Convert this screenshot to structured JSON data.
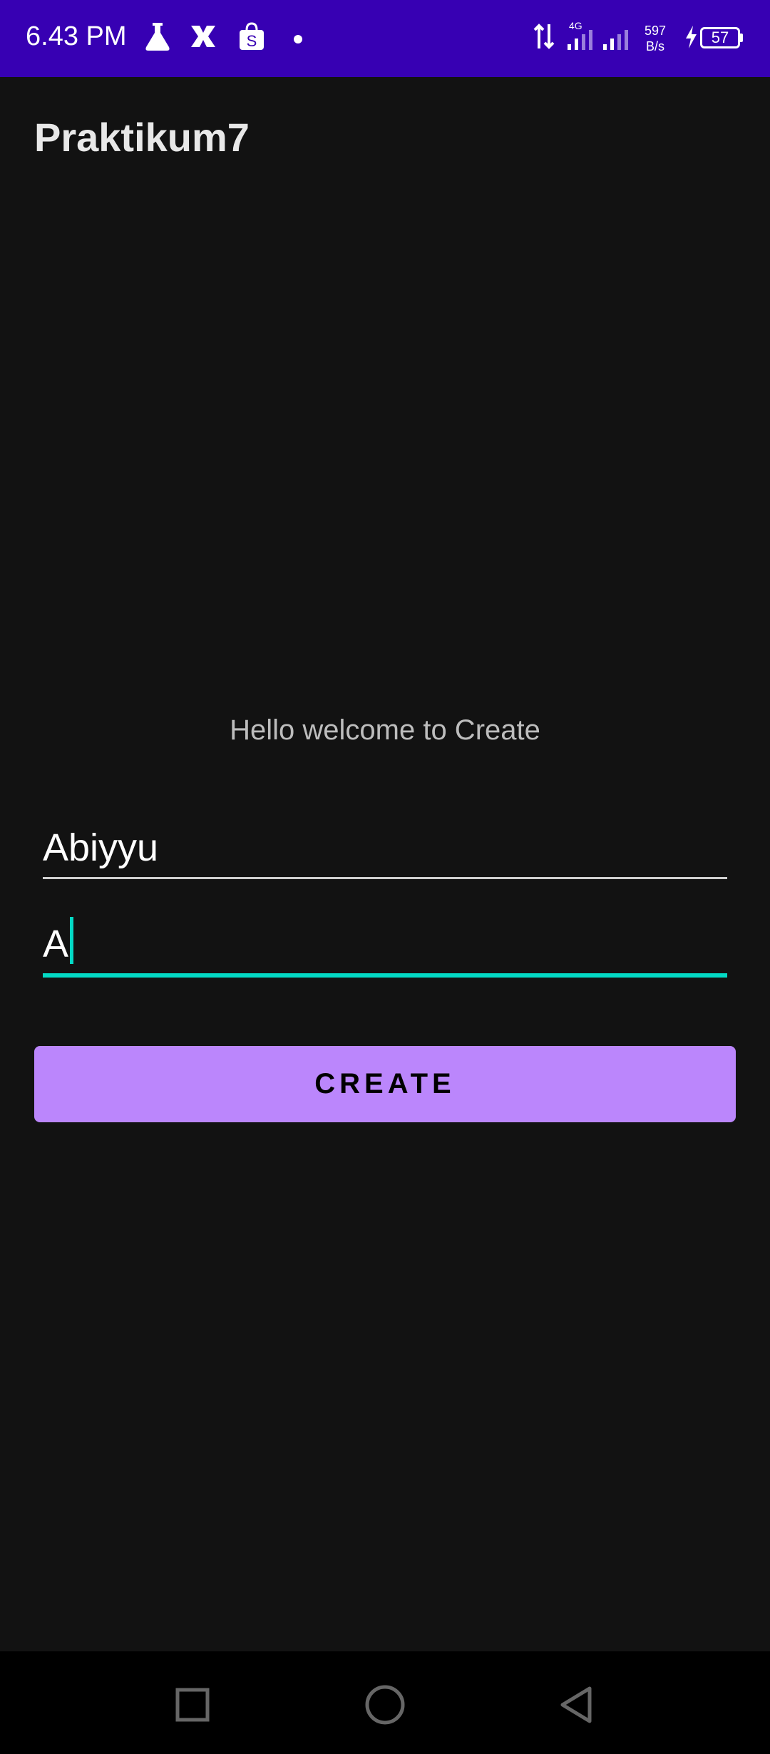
{
  "status_bar": {
    "time": "6.43 PM",
    "network_type": "4G",
    "net_speed_value": "597",
    "net_speed_unit": "B/s",
    "battery_level": "57",
    "background_color": "#3700b3"
  },
  "app": {
    "title": "Praktikum7"
  },
  "main": {
    "welcome_text": "Hello welcome to Create",
    "field1_value": "Abiyyu",
    "field2_value": "A",
    "create_button_label": "CREATE",
    "accent_color": "#bb86fc",
    "focus_color": "#03dac5"
  },
  "nav": {
    "icons": [
      "recent-apps-icon",
      "home-icon",
      "back-icon"
    ]
  }
}
